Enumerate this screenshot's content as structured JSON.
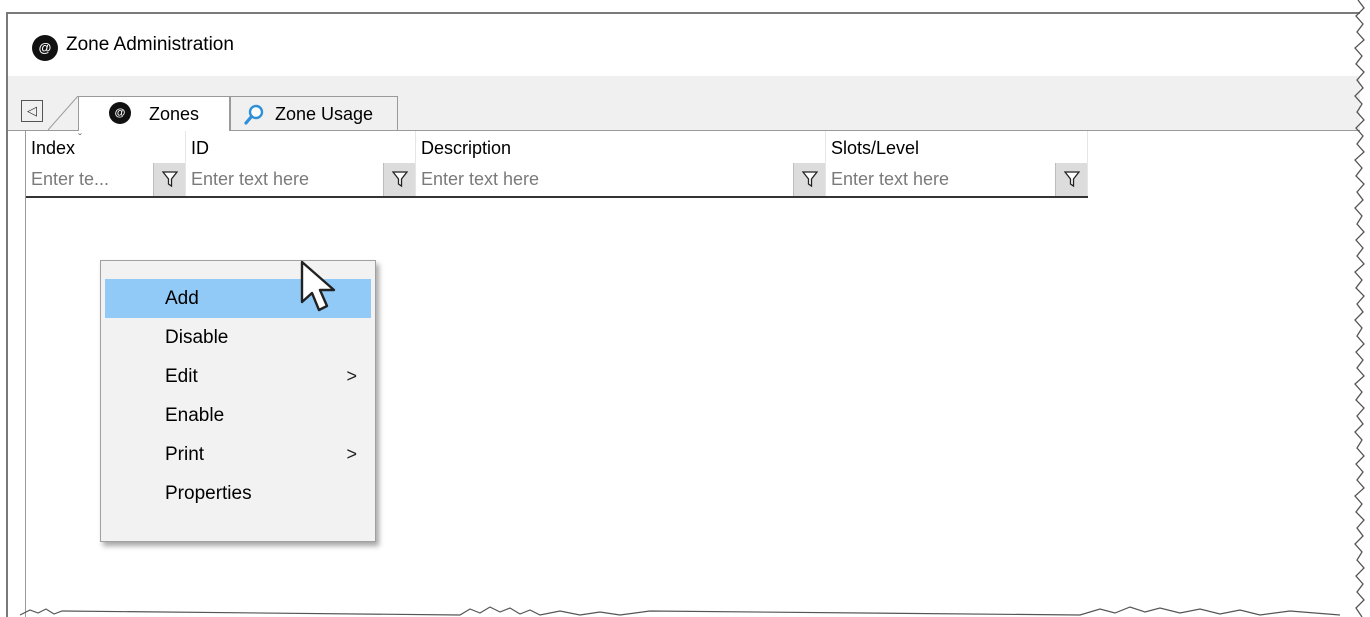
{
  "window": {
    "title": "Zone Administration",
    "app_icon_glyph": "@",
    "icon": "app-at-icon"
  },
  "tabs": {
    "scroll_left_glyph": "◁",
    "items": [
      {
        "label": "Zones",
        "icon": "app-at-icon",
        "icon_glyph": "@",
        "active": true
      },
      {
        "label": "Zone Usage",
        "icon": "magnifier-icon",
        "active": false
      }
    ]
  },
  "grid": {
    "sort_glyph": "ˇ",
    "columns": [
      {
        "label": "Index",
        "placeholder": "Enter te..."
      },
      {
        "label": "ID",
        "placeholder": "Enter text here"
      },
      {
        "label": "Description",
        "placeholder": "Enter text here"
      },
      {
        "label": "Slots/Level",
        "placeholder": "Enter text here"
      }
    ]
  },
  "context_menu": {
    "submenu_glyph": ">",
    "items": [
      {
        "label": "Add",
        "highlighted": true,
        "submenu": false
      },
      {
        "label": "Disable",
        "highlighted": false,
        "submenu": false
      },
      {
        "label": "Edit",
        "highlighted": false,
        "submenu": true
      },
      {
        "label": "Enable",
        "highlighted": false,
        "submenu": false
      },
      {
        "label": "Print",
        "highlighted": false,
        "submenu": true
      },
      {
        "label": "Properties",
        "highlighted": false,
        "submenu": false
      }
    ]
  },
  "colors": {
    "menu_highlight": "#91c9f7",
    "menu_background": "#f2f2f2",
    "tabstrip_background": "#f0f0f0",
    "magnifier_blue": "#2f8fd8"
  }
}
